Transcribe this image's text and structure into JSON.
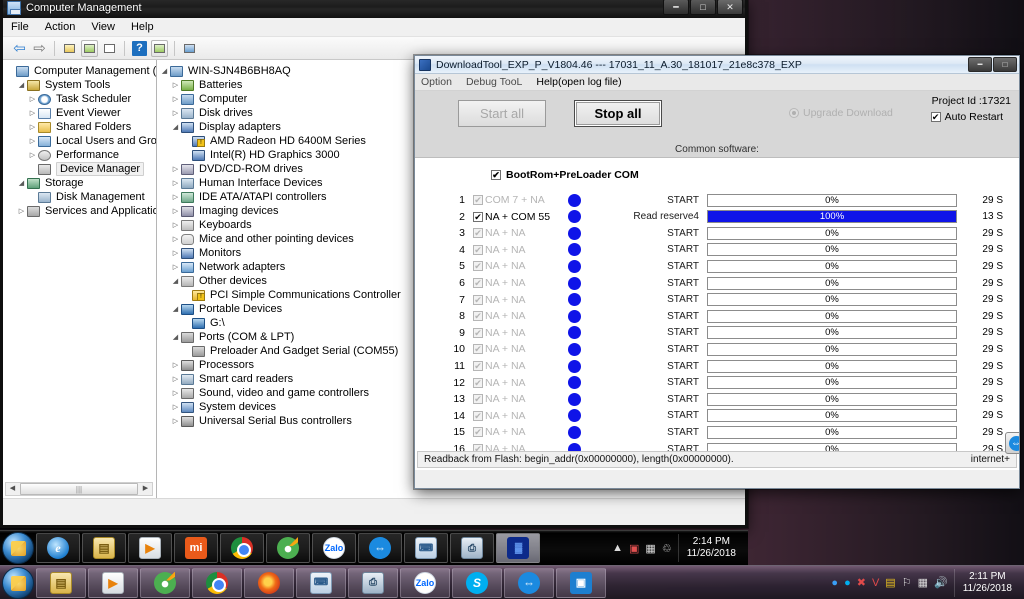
{
  "computer_management": {
    "title": "Computer Management",
    "menu": [
      "File",
      "Action",
      "View",
      "Help"
    ],
    "toolbar_icons": [
      "back-icon",
      "forward-icon",
      "up-folder-icon",
      "show-hide-console-tree-icon",
      "properties-icon",
      "help-icon",
      "show-hide-action-pane-icon",
      "scan-hardware-icon"
    ],
    "window_buttons": [
      "minimize",
      "maximize",
      "close"
    ],
    "console_tree": [
      {
        "label": "Computer Management (Local",
        "indent": 0,
        "expander": "",
        "icon": "ic-computer",
        "selected": false
      },
      {
        "label": "System Tools",
        "indent": 1,
        "expander": "open",
        "icon": "ic-tools",
        "selected": false
      },
      {
        "label": "Task Scheduler",
        "indent": 2,
        "expander": "closed",
        "icon": "ic-clock",
        "selected": false
      },
      {
        "label": "Event Viewer",
        "indent": 2,
        "expander": "closed",
        "icon": "ic-event",
        "selected": false
      },
      {
        "label": "Shared Folders",
        "indent": 2,
        "expander": "closed",
        "icon": "ic-folder",
        "selected": false
      },
      {
        "label": "Local Users and Groups",
        "indent": 2,
        "expander": "closed",
        "icon": "ic-users",
        "selected": false
      },
      {
        "label": "Performance",
        "indent": 2,
        "expander": "closed",
        "icon": "ic-perf",
        "selected": false
      },
      {
        "label": "Device Manager",
        "indent": 2,
        "expander": "",
        "icon": "ic-device",
        "selected": true
      },
      {
        "label": "Storage",
        "indent": 1,
        "expander": "open",
        "icon": "ic-storage",
        "selected": false
      },
      {
        "label": "Disk Management",
        "indent": 2,
        "expander": "",
        "icon": "ic-disk",
        "selected": false
      },
      {
        "label": "Services and Applications",
        "indent": 1,
        "expander": "closed",
        "icon": "ic-services",
        "selected": false
      }
    ],
    "device_tree": [
      {
        "label": "WIN-SJN4B6BH8AQ",
        "indent": 0,
        "expander": "open",
        "icon": "ic-computer"
      },
      {
        "label": "Batteries",
        "indent": 1,
        "expander": "closed",
        "icon": "ic-battery"
      },
      {
        "label": "Computer",
        "indent": 1,
        "expander": "closed",
        "icon": "ic-computer"
      },
      {
        "label": "Disk drives",
        "indent": 1,
        "expander": "closed",
        "icon": "ic-disk"
      },
      {
        "label": "Display adapters",
        "indent": 1,
        "expander": "open",
        "icon": "ic-display"
      },
      {
        "label": "AMD Radeon HD 6400M Series",
        "indent": 2,
        "expander": "",
        "icon": "ic-display",
        "warning": true
      },
      {
        "label": "Intel(R) HD Graphics 3000",
        "indent": 2,
        "expander": "",
        "icon": "ic-display"
      },
      {
        "label": "DVD/CD-ROM drives",
        "indent": 1,
        "expander": "closed",
        "icon": "ic-dvd"
      },
      {
        "label": "Human Interface Devices",
        "indent": 1,
        "expander": "closed",
        "icon": "ic-hid"
      },
      {
        "label": "IDE ATA/ATAPI controllers",
        "indent": 1,
        "expander": "closed",
        "icon": "ic-ide"
      },
      {
        "label": "Imaging devices",
        "indent": 1,
        "expander": "closed",
        "icon": "ic-imaging"
      },
      {
        "label": "Keyboards",
        "indent": 1,
        "expander": "closed",
        "icon": "ic-keyboard"
      },
      {
        "label": "Mice and other pointing devices",
        "indent": 1,
        "expander": "closed",
        "icon": "ic-mouse"
      },
      {
        "label": "Monitors",
        "indent": 1,
        "expander": "closed",
        "icon": "ic-monitor"
      },
      {
        "label": "Network adapters",
        "indent": 1,
        "expander": "closed",
        "icon": "ic-network"
      },
      {
        "label": "Other devices",
        "indent": 1,
        "expander": "open",
        "icon": "ic-other"
      },
      {
        "label": "PCI Simple Communications Controller",
        "indent": 2,
        "expander": "",
        "icon": "ic-warn",
        "warning": true
      },
      {
        "label": "Portable Devices",
        "indent": 1,
        "expander": "open",
        "icon": "ic-portable"
      },
      {
        "label": "G:\\",
        "indent": 2,
        "expander": "",
        "icon": "ic-portable"
      },
      {
        "label": "Ports (COM & LPT)",
        "indent": 1,
        "expander": "open",
        "icon": "ic-port"
      },
      {
        "label": "Preloader And Gadget Serial (COM55)",
        "indent": 2,
        "expander": "",
        "icon": "ic-port"
      },
      {
        "label": "Processors",
        "indent": 1,
        "expander": "closed",
        "icon": "ic-proc"
      },
      {
        "label": "Smart card readers",
        "indent": 1,
        "expander": "closed",
        "icon": "ic-smart"
      },
      {
        "label": "Sound, video and game controllers",
        "indent": 1,
        "expander": "closed",
        "icon": "ic-sound"
      },
      {
        "label": "System devices",
        "indent": 1,
        "expander": "closed",
        "icon": "ic-sysdev"
      },
      {
        "label": "Universal Serial Bus controllers",
        "indent": 1,
        "expander": "closed",
        "icon": "ic-usb"
      }
    ]
  },
  "download_tool": {
    "title": "DownloadTool_EXP_P_V1804.46 --- 17031_11_A.30_181017_21e8c378_EXP",
    "menu": [
      {
        "label": "Option",
        "enabled": false
      },
      {
        "label": "Debug TooL",
        "enabled": false
      },
      {
        "label": "Help(open log file)",
        "enabled": true
      }
    ],
    "start_all_label": "Start all",
    "stop_all_label": "Stop all",
    "upgrade_download_label": "Upgrade Download",
    "project_id_label": "Project Id :17321",
    "auto_restart_label": "Auto Restart",
    "auto_restart_checked": "✔",
    "common_software_label": "Common software:",
    "bootrom_header_label": "BootRom+PreLoader COM",
    "bootrom_header_checked": "✔",
    "status_left": "Readback from Flash:  begin_addr(0x00000000), length(0x00000000).",
    "status_right": "internet+",
    "rows": [
      {
        "idx": "1",
        "port": "COM  7 + NA",
        "checked": "✔",
        "enabled": false,
        "status": "START",
        "percent": "0%",
        "fill": 0,
        "time": "29 S"
      },
      {
        "idx": "2",
        "port": "NA + COM 55",
        "checked": "✔",
        "enabled": true,
        "status": "Read reserve4",
        "percent": "100%",
        "fill": 100,
        "time": "13 S"
      },
      {
        "idx": "3",
        "port": "NA + NA",
        "checked": "✔",
        "enabled": false,
        "status": "START",
        "percent": "0%",
        "fill": 0,
        "time": "29 S"
      },
      {
        "idx": "4",
        "port": "NA + NA",
        "checked": "✔",
        "enabled": false,
        "status": "START",
        "percent": "0%",
        "fill": 0,
        "time": "29 S"
      },
      {
        "idx": "5",
        "port": "NA + NA",
        "checked": "✔",
        "enabled": false,
        "status": "START",
        "percent": "0%",
        "fill": 0,
        "time": "29 S"
      },
      {
        "idx": "6",
        "port": "NA + NA",
        "checked": "✔",
        "enabled": false,
        "status": "START",
        "percent": "0%",
        "fill": 0,
        "time": "29 S"
      },
      {
        "idx": "7",
        "port": "NA + NA",
        "checked": "✔",
        "enabled": false,
        "status": "START",
        "percent": "0%",
        "fill": 0,
        "time": "29 S"
      },
      {
        "idx": "8",
        "port": "NA + NA",
        "checked": "✔",
        "enabled": false,
        "status": "START",
        "percent": "0%",
        "fill": 0,
        "time": "29 S"
      },
      {
        "idx": "9",
        "port": "NA + NA",
        "checked": "✔",
        "enabled": false,
        "status": "START",
        "percent": "0%",
        "fill": 0,
        "time": "29 S"
      },
      {
        "idx": "10",
        "port": "NA + NA",
        "checked": "✔",
        "enabled": false,
        "status": "START",
        "percent": "0%",
        "fill": 0,
        "time": "29 S"
      },
      {
        "idx": "11",
        "port": "NA + NA",
        "checked": "✔",
        "enabled": false,
        "status": "START",
        "percent": "0%",
        "fill": 0,
        "time": "29 S"
      },
      {
        "idx": "12",
        "port": "NA + NA",
        "checked": "✔",
        "enabled": false,
        "status": "START",
        "percent": "0%",
        "fill": 0,
        "time": "29 S"
      },
      {
        "idx": "13",
        "port": "NA + NA",
        "checked": "✔",
        "enabled": false,
        "status": "START",
        "percent": "0%",
        "fill": 0,
        "time": "29 S"
      },
      {
        "idx": "14",
        "port": "NA + NA",
        "checked": "✔",
        "enabled": false,
        "status": "START",
        "percent": "0%",
        "fill": 0,
        "time": "29 S"
      },
      {
        "idx": "15",
        "port": "NA + NA",
        "checked": "✔",
        "enabled": false,
        "status": "START",
        "percent": "0%",
        "fill": 0,
        "time": "29 S"
      },
      {
        "idx": "16",
        "port": "NA + NA",
        "checked": "✔",
        "enabled": false,
        "status": "START",
        "percent": "0%",
        "fill": 0,
        "time": "29 S"
      }
    ]
  },
  "taskbar_inner": {
    "start_label": "Start",
    "buttons": [
      {
        "name": "internet-explorer",
        "glyph": "e",
        "cls": "gi-ie"
      },
      {
        "name": "windows-explorer",
        "glyph": "▤",
        "cls": "gi-folder"
      },
      {
        "name": "media-player",
        "glyph": "▶",
        "cls": "gi-media"
      },
      {
        "name": "mi-flash-tool",
        "glyph": "mi",
        "cls": "gi-mi"
      },
      {
        "name": "google-chrome",
        "glyph": "",
        "cls": "gi-chrome"
      },
      {
        "name": "green-app",
        "glyph": "",
        "cls": "gi-green"
      },
      {
        "name": "zalo",
        "glyph": "Zalo",
        "cls": "gi-zalo"
      },
      {
        "name": "teamviewer",
        "glyph": "⇔",
        "cls": "gi-tv"
      },
      {
        "name": "remote-desktop",
        "glyph": "⌨",
        "cls": "gi-remote"
      },
      {
        "name": "printer-tool",
        "glyph": "⎙",
        "cls": "gi-printer"
      },
      {
        "name": "download-tool",
        "glyph": "▓",
        "cls": "gi-blue"
      }
    ],
    "tray_icons": [
      "show-hidden-icons",
      "antivirus-icon",
      "removable-media-icon",
      "network-icon"
    ],
    "clock_time": "2:14 PM",
    "clock_date": "11/26/2018"
  },
  "taskbar_outer": {
    "start_label": "Start",
    "buttons": [
      {
        "name": "windows-explorer",
        "glyph": "▤",
        "cls": "gi-folder"
      },
      {
        "name": "media-player",
        "glyph": "▶",
        "cls": "gi-media"
      },
      {
        "name": "green-app",
        "glyph": "",
        "cls": "gi-green"
      },
      {
        "name": "google-chrome",
        "glyph": "",
        "cls": "gi-chrome"
      },
      {
        "name": "mozilla-firefox",
        "glyph": "",
        "cls": "gi-ff"
      },
      {
        "name": "remote-desktop",
        "glyph": "⌨",
        "cls": "gi-remote"
      },
      {
        "name": "printer-tool",
        "glyph": "⎙",
        "cls": "gi-printer"
      },
      {
        "name": "zalo",
        "glyph": "Zalo",
        "cls": "gi-zalo"
      },
      {
        "name": "skype",
        "glyph": "S",
        "cls": "gi-skype"
      },
      {
        "name": "teamviewer",
        "glyph": "⇔",
        "cls": "gi-tv"
      },
      {
        "name": "screen-app",
        "glyph": "▣",
        "cls": "gi-screen"
      }
    ],
    "tray_icons": [
      "zalo-icon",
      "skype-icon",
      "security-icon",
      "vlc-icon",
      "dictionary-icon",
      "flag-icon",
      "network-icon",
      "volume-icon"
    ],
    "clock_time": "2:11 PM",
    "clock_date": "11/26/2018"
  }
}
